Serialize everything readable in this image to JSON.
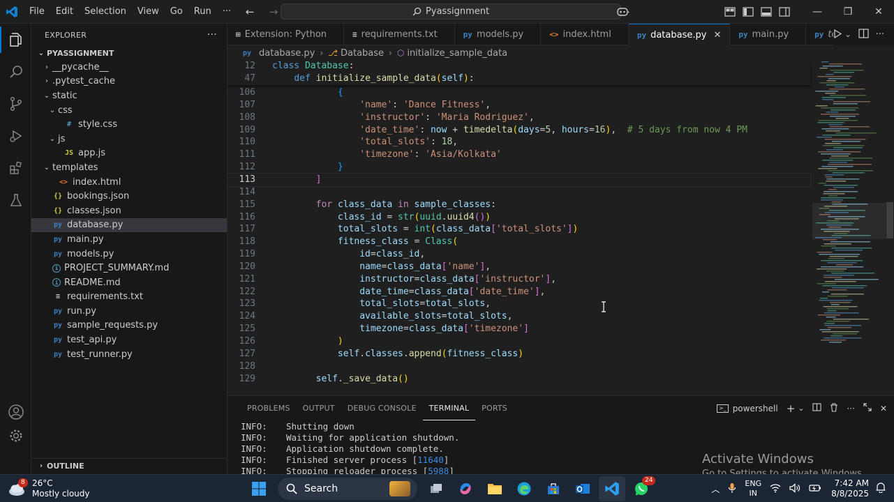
{
  "titlebar": {
    "menu": [
      "File",
      "Edit",
      "Selection",
      "View",
      "Go",
      "Run"
    ],
    "more": "···",
    "search": "Pyassignment"
  },
  "explorer": {
    "title": "EXPLORER",
    "project": "PYASSIGNMENT",
    "outline": "OUTLINE",
    "tree": [
      {
        "label": "__pycache__",
        "indent": 1,
        "twisty": "›",
        "icon": ""
      },
      {
        "label": ".pytest_cache",
        "indent": 1,
        "twisty": "›",
        "icon": ""
      },
      {
        "label": "static",
        "indent": 1,
        "twisty": "⌄",
        "icon": ""
      },
      {
        "label": "css",
        "indent": 2,
        "twisty": "⌄",
        "icon": ""
      },
      {
        "label": "style.css",
        "indent": 3,
        "twisty": "",
        "icon": "#"
      },
      {
        "label": "js",
        "indent": 2,
        "twisty": "⌄",
        "icon": ""
      },
      {
        "label": "app.js",
        "indent": 3,
        "twisty": "",
        "icon": "JS"
      },
      {
        "label": "templates",
        "indent": 1,
        "twisty": "⌄",
        "icon": ""
      },
      {
        "label": "index.html",
        "indent": 2,
        "twisty": "",
        "icon": "<>"
      },
      {
        "label": "bookings.json",
        "indent": 1,
        "twisty": "",
        "icon": "{}"
      },
      {
        "label": "classes.json",
        "indent": 1,
        "twisty": "",
        "icon": "{}"
      },
      {
        "label": "database.py",
        "indent": 1,
        "twisty": "",
        "icon": "py",
        "selected": true
      },
      {
        "label": "main.py",
        "indent": 1,
        "twisty": "",
        "icon": "py"
      },
      {
        "label": "models.py",
        "indent": 1,
        "twisty": "",
        "icon": "py"
      },
      {
        "label": "PROJECT_SUMMARY.md",
        "indent": 1,
        "twisty": "",
        "icon": "i"
      },
      {
        "label": "README.md",
        "indent": 1,
        "twisty": "",
        "icon": "i"
      },
      {
        "label": "requirements.txt",
        "indent": 1,
        "twisty": "",
        "icon": "≡"
      },
      {
        "label": "run.py",
        "indent": 1,
        "twisty": "",
        "icon": "py"
      },
      {
        "label": "sample_requests.py",
        "indent": 1,
        "twisty": "",
        "icon": "py"
      },
      {
        "label": "test_api.py",
        "indent": 1,
        "twisty": "",
        "icon": "py"
      },
      {
        "label": "test_runner.py",
        "indent": 1,
        "twisty": "",
        "icon": "py"
      }
    ]
  },
  "tabs": [
    {
      "label": "Extension: Python",
      "icon": "⊞",
      "active": false
    },
    {
      "label": "requirements.txt",
      "icon": "≡",
      "active": false
    },
    {
      "label": "models.py",
      "icon": "py",
      "active": false
    },
    {
      "label": "index.html",
      "icon": "<>",
      "active": false
    },
    {
      "label": "database.py",
      "icon": "py",
      "active": true
    },
    {
      "label": "main.py",
      "icon": "py",
      "active": false
    },
    {
      "label": "test_api.py",
      "icon": "py",
      "active": false,
      "italic": true
    }
  ],
  "breadcrumb": {
    "file": "database.py",
    "cls": "Database",
    "method": "initialize_sample_data"
  },
  "sticky": [
    {
      "n": "12",
      "html": "<span class=\"kw\">class</span> <span class=\"cls\">Database</span><span class=\"pn\">:</span>"
    },
    {
      "n": "47",
      "html": "    <span class=\"kw\">def</span> <span class=\"fn\">initialize_sample_data</span><span class=\"br1\">(</span><span class=\"var\">self</span><span class=\"br1\">)</span><span class=\"pn\">:</span>"
    }
  ],
  "code": [
    {
      "n": "106",
      "html": "            <span class=\"br3\">{</span>"
    },
    {
      "n": "107",
      "html": "                <span class=\"str\">'name'</span><span class=\"pn\">: </span><span class=\"str\">'Dance Fitness'</span><span class=\"pn\">,</span>"
    },
    {
      "n": "108",
      "html": "                <span class=\"str\">'instructor'</span><span class=\"pn\">: </span><span class=\"str\">'Maria Rodriguez'</span><span class=\"pn\">,</span>"
    },
    {
      "n": "109",
      "html": "                <span class=\"str\">'date_time'</span><span class=\"pn\">: </span><span class=\"var\">now</span><span class=\"pn\"> + </span><span class=\"fn\">timedelta</span><span class=\"br1\">(</span><span class=\"var\">days</span><span class=\"pn\">=</span><span class=\"num\">5</span><span class=\"pn\">, </span><span class=\"var\">hours</span><span class=\"pn\">=</span><span class=\"num\">16</span><span class=\"br1\">)</span><span class=\"pn\">,  </span><span class=\"cmt\"># 5 days from now 4 PM</span>"
    },
    {
      "n": "110",
      "html": "                <span class=\"str\">'total_slots'</span><span class=\"pn\">: </span><span class=\"num\">18</span><span class=\"pn\">,</span>"
    },
    {
      "n": "111",
      "html": "                <span class=\"str\">'timezone'</span><span class=\"pn\">: </span><span class=\"str\">'Asia/Kolkata'</span>"
    },
    {
      "n": "112",
      "html": "            <span class=\"br3\">}</span>"
    },
    {
      "n": "113",
      "html": "        <span class=\"br2\">]</span>",
      "current": true
    },
    {
      "n": "114",
      "html": ""
    },
    {
      "n": "115",
      "html": "        <span class=\"kw2\">for</span> <span class=\"var\">class_data</span> <span class=\"kw2\">in</span> <span class=\"var\">sample_classes</span><span class=\"pn\">:</span>"
    },
    {
      "n": "116",
      "html": "            <span class=\"var\">class_id</span><span class=\"pn\"> = </span><span class=\"cls\">str</span><span class=\"br1\">(</span><span class=\"cls\">uuid</span><span class=\"pn\">.</span><span class=\"fn\">uuid4</span><span class=\"br2\">()</span><span class=\"br1\">)</span>"
    },
    {
      "n": "117",
      "html": "            <span class=\"var\">total_slots</span><span class=\"pn\"> = </span><span class=\"cls\">int</span><span class=\"br1\">(</span><span class=\"var\">class_data</span><span class=\"br2\">[</span><span class=\"str\">'total_slots'</span><span class=\"br2\">]</span><span class=\"br1\">)</span>"
    },
    {
      "n": "118",
      "html": "            <span class=\"var\">fitness_class</span><span class=\"pn\"> = </span><span class=\"cls\">Class</span><span class=\"br1\">(</span>"
    },
    {
      "n": "119",
      "html": "                <span class=\"var\">id</span><span class=\"pn\">=</span><span class=\"var\">class_id</span><span class=\"pn\">,</span>"
    },
    {
      "n": "120",
      "html": "                <span class=\"var\">name</span><span class=\"pn\">=</span><span class=\"var\">class_data</span><span class=\"br2\">[</span><span class=\"str\">'name'</span><span class=\"br2\">]</span><span class=\"pn\">,</span>"
    },
    {
      "n": "121",
      "html": "                <span class=\"var\">instructor</span><span class=\"pn\">=</span><span class=\"var\">class_data</span><span class=\"br2\">[</span><span class=\"str\">'instructor'</span><span class=\"br2\">]</span><span class=\"pn\">,</span>"
    },
    {
      "n": "122",
      "html": "                <span class=\"var\">date_time</span><span class=\"pn\">=</span><span class=\"var\">class_data</span><span class=\"br2\">[</span><span class=\"str\">'date_time'</span><span class=\"br2\">]</span><span class=\"pn\">,</span>"
    },
    {
      "n": "123",
      "html": "                <span class=\"var\">total_slots</span><span class=\"pn\">=</span><span class=\"var\">total_slots</span><span class=\"pn\">,</span>"
    },
    {
      "n": "124",
      "html": "                <span class=\"var\">available_slots</span><span class=\"pn\">=</span><span class=\"var\">total_slots</span><span class=\"pn\">,</span>"
    },
    {
      "n": "125",
      "html": "                <span class=\"var\">timezone</span><span class=\"pn\">=</span><span class=\"var\">class_data</span><span class=\"br2\">[</span><span class=\"str\">'timezone'</span><span class=\"br2\">]</span>"
    },
    {
      "n": "126",
      "html": "            <span class=\"br1\">)</span>"
    },
    {
      "n": "127",
      "html": "            <span class=\"var\">self</span><span class=\"pn\">.</span><span class=\"var\">classes</span><span class=\"pn\">.</span><span class=\"fn\">append</span><span class=\"br1\">(</span><span class=\"var\">fitness_class</span><span class=\"br1\">)</span>"
    },
    {
      "n": "128",
      "html": ""
    },
    {
      "n": "129",
      "html": "        <span class=\"var\">self</span><span class=\"pn\">.</span><span class=\"fn\">_save_data</span><span class=\"br1\">()</span>"
    }
  ],
  "panel": {
    "tabs": [
      "PROBLEMS",
      "OUTPUT",
      "DEBUG CONSOLE",
      "TERMINAL",
      "PORTS"
    ],
    "active_tab": "TERMINAL",
    "shell": "powershell",
    "lines": [
      {
        "level": "INFO:",
        "msg": "Shutting down",
        "num": ""
      },
      {
        "level": "INFO:",
        "msg": "Waiting for application shutdown.",
        "num": ""
      },
      {
        "level": "INFO:",
        "msg": "Application shutdown complete.",
        "num": ""
      },
      {
        "level": "INFO:",
        "msg": "Finished server process [",
        "num": "11640",
        "after": "]"
      },
      {
        "level": "INFO:",
        "msg": "Stopping reloader process [",
        "num": "5988",
        "after": "]"
      }
    ],
    "watermark_title": "Activate Windows",
    "watermark_sub": "Go to Settings to activate Windows."
  },
  "taskbar": {
    "weather_badge": "8",
    "temp": "26°C",
    "condition": "Mostly cloudy",
    "search": "Search",
    "whatsapp_badge": "24",
    "lang1": "ENG",
    "lang2": "IN",
    "time": "7:42 AM",
    "date": "8/8/2025"
  },
  "colors": {
    "accent": "#0078d4",
    "editor_bg": "#1f1f1f",
    "sidebar_bg": "#181818",
    "taskbar_bg": "#1c2534"
  }
}
